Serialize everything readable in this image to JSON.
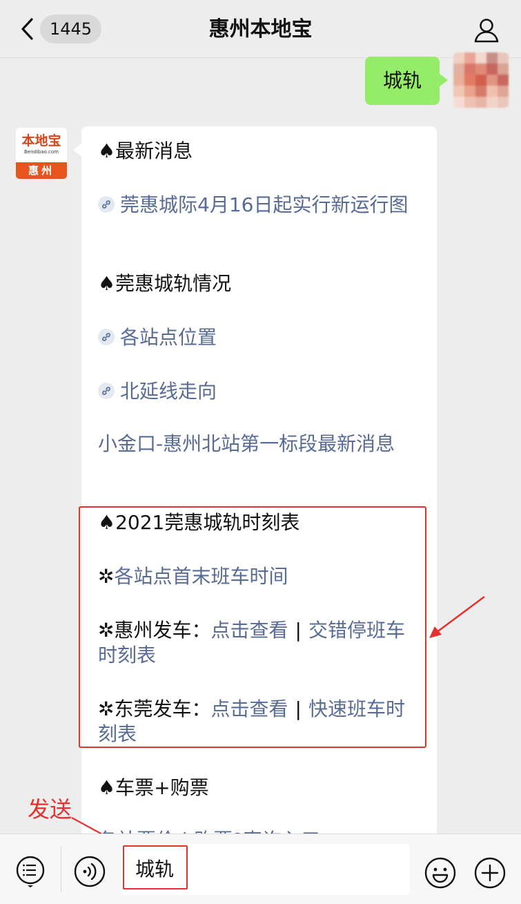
{
  "header": {
    "back_count": "1445",
    "title": "惠州本地宝"
  },
  "outgoing": {
    "text": "城轨"
  },
  "sender_logo": {
    "name_cn": "本地宝",
    "name_en": "Bendibao.com",
    "city": "惠州"
  },
  "message": {
    "h_latest": "♠最新消息",
    "link_latest": "莞惠城际4月16日起实行新运行图",
    "h_status": "♠莞惠城轨情况",
    "link_stations": "各站点位置",
    "link_north": "北延线走向",
    "link_xiaojinkou": "小金口-惠州北站第一标段最新消息",
    "h_timetable": "♠2021莞惠城轨时刻表",
    "star": "✲",
    "link_first_last": "各站点首末班车时间",
    "huizhou_label": "惠州发车：",
    "click_view": "点击查看",
    "separator": "|",
    "link_staggered": "交错停班车时刻表",
    "dongguan_label": "东莞发车：",
    "link_express": "快速班车时刻表",
    "h_tickets": "♠车票+购票",
    "partial_line": "各站票价 | 购票?直询入口"
  },
  "annotations": {
    "send_label": "发送"
  },
  "input": {
    "value": "城轨"
  },
  "colors": {
    "link": "#576b95",
    "outgoing_bubble": "#95ec69",
    "highlight": "#e5302d"
  }
}
